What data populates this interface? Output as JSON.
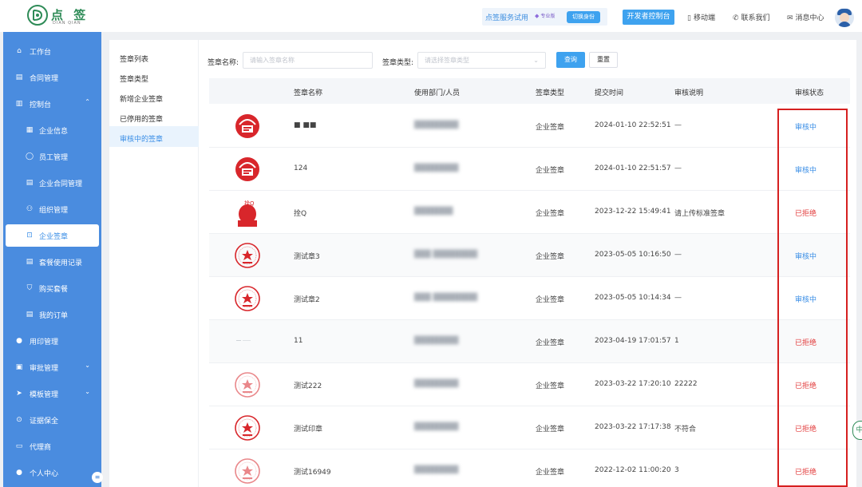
{
  "brand": {
    "name_cn": "点 签",
    "name_en": "DIAN QIAN"
  },
  "header": {
    "trial_text": "点签服务试用",
    "pro_badge": "专业版",
    "switch_identity": "切换身份",
    "dev_console": "开发者控制台",
    "mobile": "移动端",
    "contact": "联系我们",
    "messages": "消息中心"
  },
  "sidebar": {
    "items": [
      {
        "label": "工作台",
        "icon": "home-icon"
      },
      {
        "label": "合同管理",
        "icon": "document-icon"
      },
      {
        "label": "控制台",
        "icon": "bar-chart-icon"
      },
      {
        "label": "企业信息",
        "icon": "building-icon"
      },
      {
        "label": "员工管理",
        "icon": "user-icon"
      },
      {
        "label": "企业合同管理",
        "icon": "contract-icon"
      },
      {
        "label": "组织管理",
        "icon": "org-icon"
      },
      {
        "label": "企业签章",
        "icon": "stamp-icon"
      },
      {
        "label": "套餐使用记录",
        "icon": "record-icon"
      },
      {
        "label": "购买套餐",
        "icon": "cart-icon"
      },
      {
        "label": "我的订单",
        "icon": "order-icon"
      },
      {
        "label": "用印管理",
        "icon": "seal-user-icon"
      },
      {
        "label": "审批管理",
        "icon": "approve-icon"
      },
      {
        "label": "模板管理",
        "icon": "template-icon"
      },
      {
        "label": "证据保全",
        "icon": "lock-icon"
      },
      {
        "label": "代理商",
        "icon": "agent-icon"
      },
      {
        "label": "个人中心",
        "icon": "person-icon"
      }
    ]
  },
  "subnav": {
    "items": [
      {
        "label": "签章列表"
      },
      {
        "label": "签章类型"
      },
      {
        "label": "新增企业签章"
      },
      {
        "label": "已停用的签章"
      },
      {
        "label": "审核中的签章"
      }
    ]
  },
  "filters": {
    "name_label": "签章名称:",
    "name_placeholder": "请输入签章名称",
    "type_label": "签章类型:",
    "type_placeholder": "请选择签章类型",
    "query": "查询",
    "reset": "重置"
  },
  "table": {
    "headers": [
      "签章名称",
      "使用部门/人员",
      "签章类型",
      "提交时间",
      "审核说明",
      "审核状态"
    ],
    "rows": [
      {
        "name": "■ ■■",
        "dept": "████████",
        "type": "企业签章",
        "time": "2024-01-10 22:52:51",
        "note": "—",
        "status": "审核中",
        "state": "pending",
        "seal": "red-badge"
      },
      {
        "name": "124",
        "dept": "████████",
        "type": "企业签章",
        "time": "2024-01-10 22:51:57",
        "note": "—",
        "status": "审核中",
        "state": "pending",
        "seal": "red-badge"
      },
      {
        "name": "拴Q",
        "dept": "███████",
        "type": "企业签章",
        "time": "2023-12-22 15:49:41",
        "note": "请上传标准签章",
        "status": "已拒绝",
        "state": "rejected",
        "seal": "red-head"
      },
      {
        "name": "测试章3",
        "dept": "███ ████████",
        "type": "企业签章",
        "time": "2023-05-05 10:16:50",
        "note": "—",
        "status": "审核中",
        "state": "pending",
        "seal": "round"
      },
      {
        "name": "测试章2",
        "dept": "███ ████████",
        "type": "企业签章",
        "time": "2023-05-05 10:14:34",
        "note": "—",
        "status": "审核中",
        "state": "pending",
        "seal": "round"
      },
      {
        "name": "11",
        "dept": "████████",
        "type": "企业签章",
        "time": "2023-04-19 17:01:57",
        "note": "1",
        "status": "已拒绝",
        "state": "rejected",
        "seal": "faint"
      },
      {
        "name": "测试222",
        "dept": "████████",
        "type": "企业签章",
        "time": "2023-03-22 17:20:10",
        "note": "22222",
        "status": "已拒绝",
        "state": "rejected",
        "seal": "round-light"
      },
      {
        "name": "测试印章",
        "dept": "████████",
        "type": "企业签章",
        "time": "2023-03-22 17:17:38",
        "note": "不符合",
        "status": "已拒绝",
        "state": "rejected",
        "seal": "round"
      },
      {
        "name": "测试16949",
        "dept": "████████",
        "type": "企业签章",
        "time": "2022-12-02 11:00:20",
        "note": "3",
        "status": "已拒绝",
        "state": "rejected",
        "seal": "round-light"
      }
    ]
  },
  "float_badge": "中",
  "colors": {
    "primary": "#3ea2ef",
    "sidebar": "#4a8cdf",
    "rejected": "#e23b3b",
    "pending": "#3a8ee6",
    "highlight": "#d62020"
  }
}
